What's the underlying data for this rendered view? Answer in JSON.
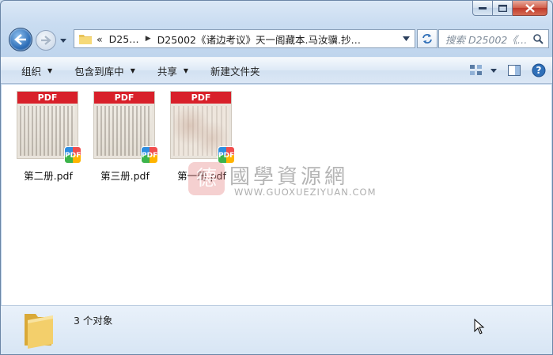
{
  "window": {
    "caption": {
      "minimize": "minimize",
      "maximize": "maximize",
      "close": "close"
    }
  },
  "nav": {
    "breadcrumb_prefix": "«",
    "crumbs": [
      "D25…",
      "D25002《诸边考议》天一阁藏本.马汝骥.抄…"
    ],
    "search_placeholder": "搜索 D25002《…"
  },
  "toolbar": {
    "organize": "组织",
    "include_in_library": "包含到库中",
    "share": "共享",
    "new_folder": "新建文件夹"
  },
  "files": [
    {
      "name": "第二册.pdf",
      "badge": "PDF",
      "thumb_label": "PDF"
    },
    {
      "name": "第三册.pdf",
      "badge": "PDF",
      "thumb_label": "PDF"
    },
    {
      "name": "第一册.pdf",
      "badge": "PDF",
      "thumb_label": "PDF"
    }
  ],
  "watermark": {
    "seal_char": "德",
    "title": "國學資源網",
    "url": "WWW.GUOXUEZIYUAN.COM"
  },
  "status": {
    "count_text": "3 个对象"
  },
  "colors": {
    "accent": "#2f6fb8",
    "pdf_red": "#d8202a",
    "close_red": "#c0392b"
  }
}
